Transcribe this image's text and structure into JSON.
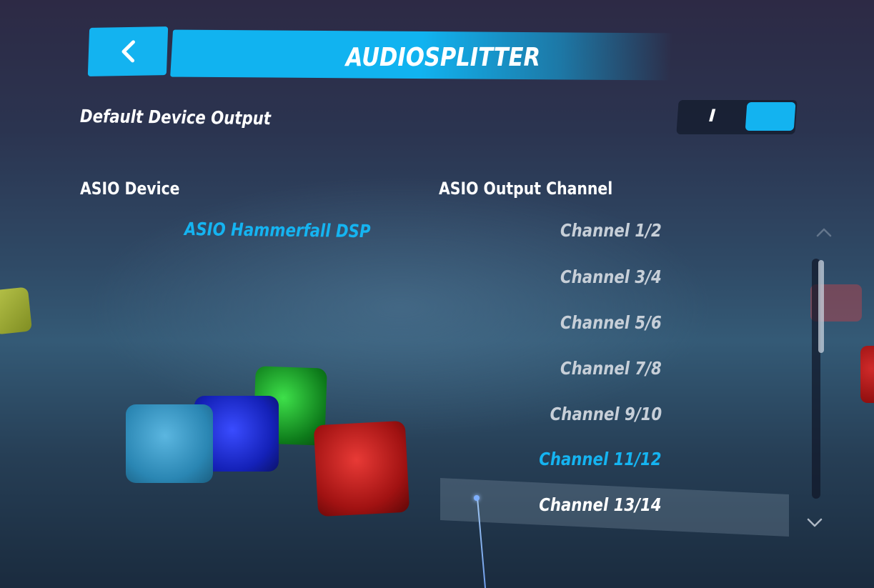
{
  "header": {
    "back_icon": "chevron-left-icon",
    "title": "AUDIOSPLITTER"
  },
  "settings": {
    "default_device_output": {
      "label": "Default Device Output",
      "toggle_on_label": "I",
      "enabled": true
    }
  },
  "asio_device": {
    "header": "ASIO Device",
    "items": [
      "ASIO Hammerfall DSP"
    ],
    "selected": "ASIO Hammerfall DSP"
  },
  "asio_output_channel": {
    "header": "ASIO Output Channel",
    "items": [
      "Channel 1/2",
      "Channel 3/4",
      "Channel 5/6",
      "Channel 7/8",
      "Channel 9/10",
      "Channel 11/12",
      "Channel 13/14"
    ],
    "selected": "Channel 11/12",
    "hovered": "Channel 13/14"
  },
  "scrollbar": {
    "up_icon": "chevron-up-icon",
    "down_icon": "chevron-down-icon"
  },
  "colors": {
    "accent": "#13b3f0",
    "text": "#ffffff",
    "item_text": "#c7cfd8"
  }
}
